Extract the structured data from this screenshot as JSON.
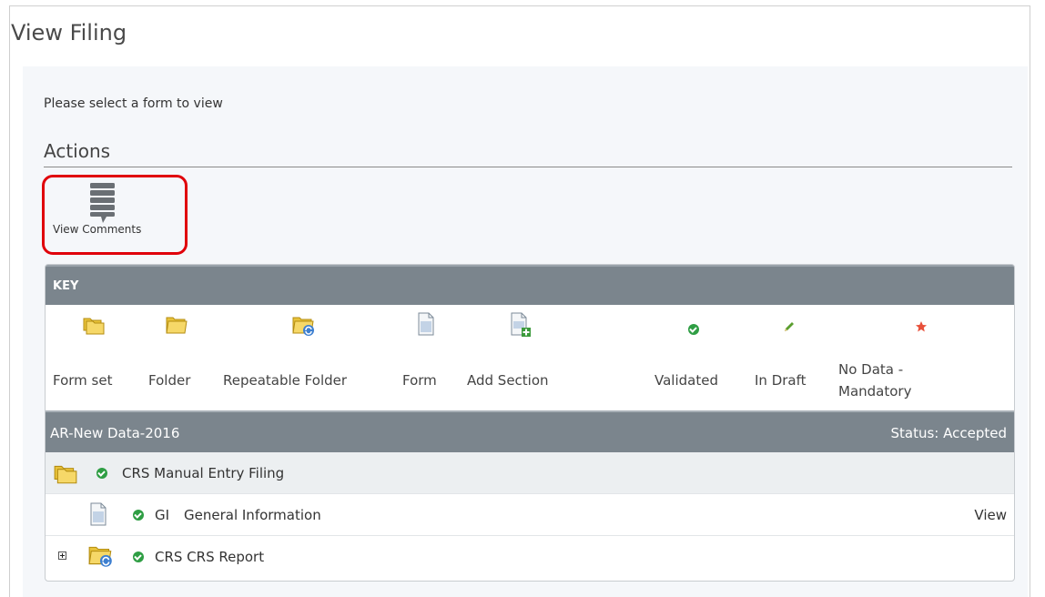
{
  "page": {
    "title": "View Filing",
    "prompt": "Please select a form to view"
  },
  "actions": {
    "heading": "Actions",
    "view_comments_label": "View Comments",
    "highlight_color": "#e0000a"
  },
  "key": {
    "heading": "KEY",
    "items": [
      {
        "label": "Form set",
        "icon": "form-set-icon"
      },
      {
        "label": "Folder",
        "icon": "folder-icon"
      },
      {
        "label": "Repeatable Folder",
        "icon": "repeatable-folder-icon"
      },
      {
        "label": "Form",
        "icon": "form-icon"
      },
      {
        "label": "Add Section",
        "icon": "add-section-icon"
      },
      {
        "label": "Validated",
        "icon": "validated-icon"
      },
      {
        "label": "In Draft",
        "icon": "in-draft-icon"
      },
      {
        "label": "No Data -",
        "label2": "Mandatory",
        "icon": "no-data-mandatory-icon"
      }
    ]
  },
  "filing": {
    "name": "AR-New Data-2016",
    "status": "Status: Accepted",
    "rows": [
      {
        "label": "CRS Manual Entry Filing",
        "icon": "form-set-icon",
        "status_icon": "validated-icon"
      },
      {
        "code": "GI",
        "label": "General Information",
        "icon": "form-icon",
        "status_icon": "validated-icon",
        "action": "View"
      },
      {
        "label": "CRS CRS Report",
        "icon": "repeatable-folder-icon",
        "status_icon": "validated-icon"
      }
    ]
  },
  "colors": {
    "header_bg": "#7b858d",
    "validated": "#2f9e44",
    "in_draft": "#5a9e2f",
    "mandatory": "#e8503a"
  }
}
